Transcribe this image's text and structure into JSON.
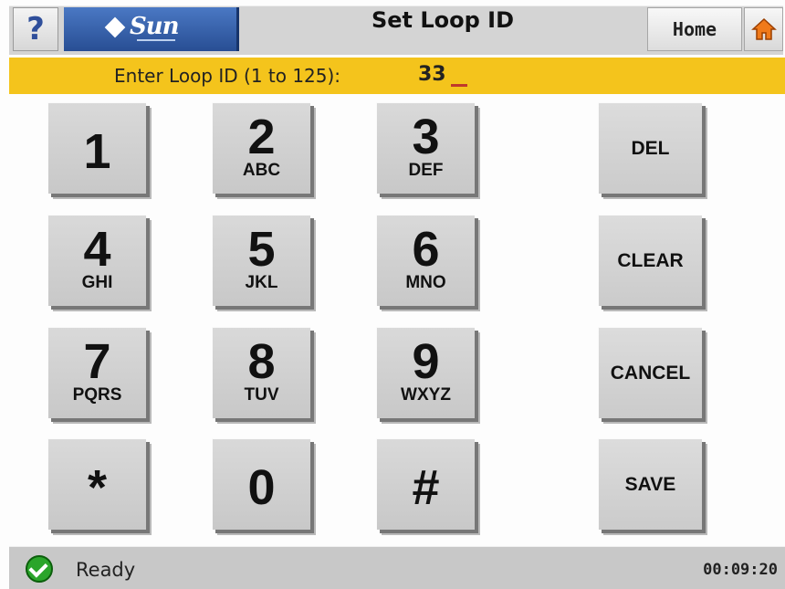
{
  "titlebar": {
    "help_label": "?",
    "logo_text": "Sun",
    "title": "Set Loop ID",
    "home_label": "Home",
    "home_icon": "home-icon"
  },
  "entry": {
    "label": "Enter Loop ID (1 to 125):",
    "value": "33"
  },
  "keypad": {
    "k1": {
      "digit": "1",
      "letters": ""
    },
    "k2": {
      "digit": "2",
      "letters": "ABC"
    },
    "k3": {
      "digit": "3",
      "letters": "DEF"
    },
    "k4": {
      "digit": "4",
      "letters": "GHI"
    },
    "k5": {
      "digit": "5",
      "letters": "JKL"
    },
    "k6": {
      "digit": "6",
      "letters": "MNO"
    },
    "k7": {
      "digit": "7",
      "letters": "PQRS"
    },
    "k8": {
      "digit": "8",
      "letters": "TUV"
    },
    "k9": {
      "digit": "9",
      "letters": "WXYZ"
    },
    "kstar": {
      "digit": "*",
      "letters": ""
    },
    "k0": {
      "digit": "0",
      "letters": ""
    },
    "khash": {
      "digit": "#",
      "letters": ""
    }
  },
  "actions": {
    "del": "DEL",
    "clear": "CLEAR",
    "cancel": "CANCEL",
    "save": "SAVE"
  },
  "status": {
    "text": "Ready",
    "time": "00:09:20",
    "icon": "checkmark-icon"
  },
  "colors": {
    "entry_bar": "#f4c41c",
    "logo_blue": "#284e94",
    "status_green": "#2aa52a",
    "home_orange": "#f07a1a"
  }
}
